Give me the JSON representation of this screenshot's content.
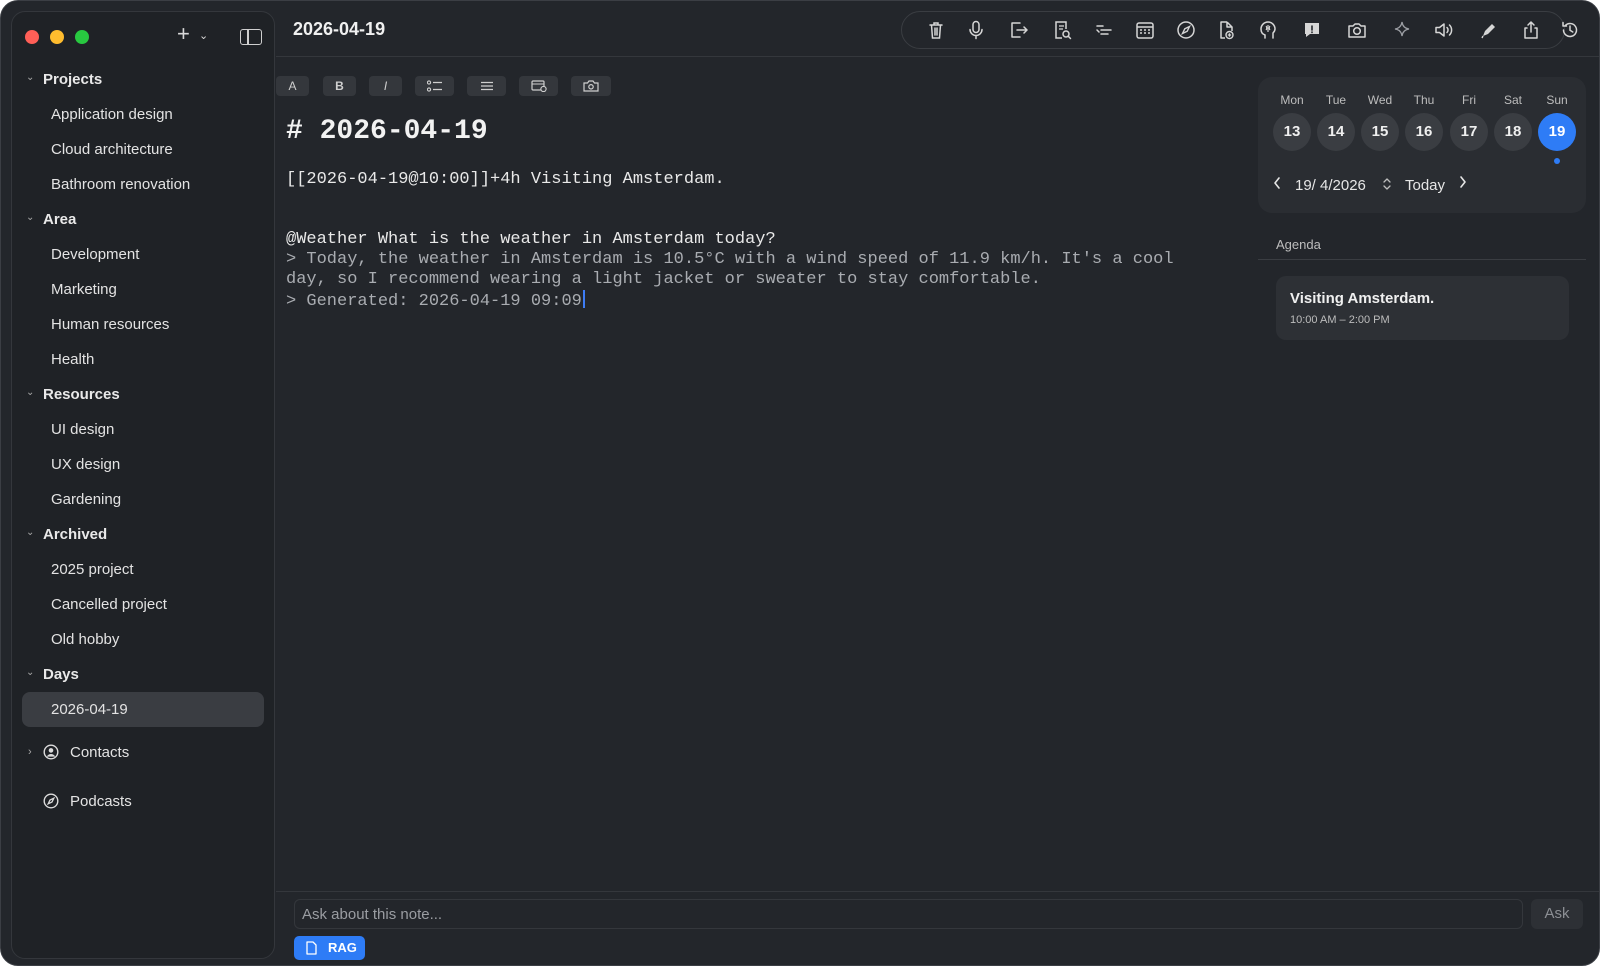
{
  "sidebar": {
    "groups": [
      {
        "label": "Projects",
        "items": [
          "Application design",
          "Cloud architecture",
          "Bathroom renovation"
        ]
      },
      {
        "label": "Area",
        "items": [
          "Development",
          "Marketing",
          "Human resources",
          "Health"
        ]
      },
      {
        "label": "Resources",
        "items": [
          "UI design",
          "UX design",
          "Gardening"
        ]
      },
      {
        "label": "Archived",
        "items": [
          "2025 project",
          "Cancelled project",
          "Old hobby"
        ]
      },
      {
        "label": "Days",
        "items": [
          "2026-04-19"
        ]
      }
    ],
    "contacts_label": "Contacts",
    "podcasts_label": "Podcasts"
  },
  "header": {
    "title": "2026-04-19",
    "toolbar_icons": [
      "trash-icon",
      "microphone-icon",
      "export-icon",
      "search-document-icon",
      "indent-icon",
      "calendar-icon",
      "compass-icon",
      "add-file-icon",
      "brain-icon",
      "chat-icon",
      "camera-icon",
      "sparkle-icon",
      "speaker-icon",
      "pen-icon",
      "share-icon",
      "history-icon"
    ]
  },
  "format_bar": {
    "font_label": "A",
    "bold_label": "B",
    "italic_label": "I"
  },
  "editor": {
    "heading": "# 2026-04-19",
    "event_line": "[[2026-04-19@10:00]]+4h Visiting Amsterdam.",
    "query_line": "@Weather What is the weather in Amsterdam today?",
    "answer_line_1": "> Today, the weather in Amsterdam is 10.5°C with a wind speed of 11.9 km/h. It's a cool",
    "answer_line_2": "day, so I recommend wearing a light jacket or sweater to stay comfortable.",
    "generated_line": "> Generated: 2026-04-19 09:09"
  },
  "calendar": {
    "weekdays": [
      "Mon",
      "Tue",
      "Wed",
      "Thu",
      "Fri",
      "Sat",
      "Sun"
    ],
    "dates": [
      "13",
      "14",
      "15",
      "16",
      "17",
      "18",
      "19"
    ],
    "selected_date": "19",
    "date_field": "19/  4/2026",
    "today_label": "Today",
    "accent_color": "#2e7cf6"
  },
  "agenda": {
    "label": "Agenda",
    "event_title": "Visiting Amsterdam.",
    "event_time": "10:00 AM – 2:00 PM"
  },
  "ask": {
    "placeholder": "Ask about this note...",
    "button_label": "Ask",
    "rag_label": "RAG"
  }
}
